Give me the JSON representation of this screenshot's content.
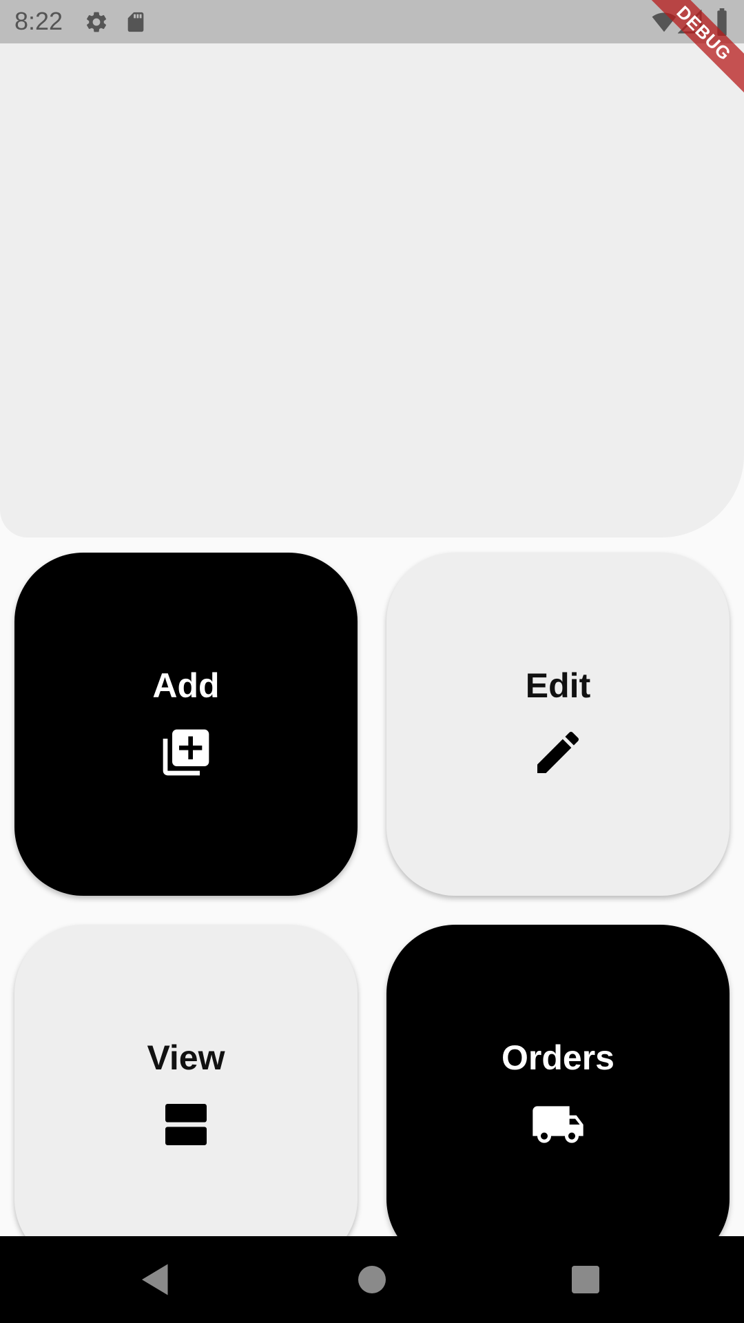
{
  "status_bar": {
    "time": "8:22",
    "icons": [
      "gear-icon",
      "sd-card-icon",
      "wifi-icon",
      "signal-icon",
      "battery-icon"
    ],
    "background": "#bdbdbd"
  },
  "debug_banner": {
    "label": "DEBUG",
    "color": "#b71c1c"
  },
  "tiles": [
    {
      "label": "Add",
      "icon": "add-to-library-icon",
      "theme": "dark"
    },
    {
      "label": "Edit",
      "icon": "pencil-icon",
      "theme": "light"
    },
    {
      "label": "View",
      "icon": "view-agenda-icon",
      "theme": "light"
    },
    {
      "label": "Orders",
      "icon": "truck-icon",
      "theme": "dark"
    }
  ],
  "nav_bar": {
    "buttons": [
      "back-icon",
      "home-icon",
      "recents-icon"
    ]
  },
  "colors": {
    "page_background": "#fafafa",
    "banner": "#eeeeee",
    "tile_dark": "#000000",
    "tile_light": "#eeeeee"
  }
}
